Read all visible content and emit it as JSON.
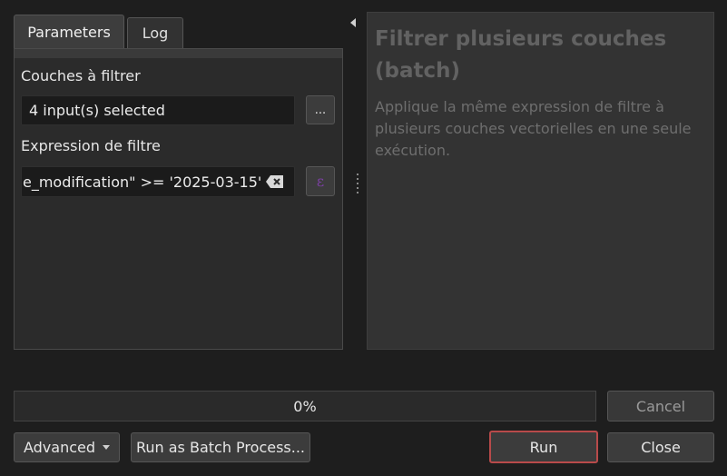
{
  "tabs": [
    {
      "label": "Parameters"
    },
    {
      "label": "Log"
    }
  ],
  "params": {
    "layers_label": "Couches à filtrer",
    "layers_value": "4 input(s) selected",
    "layers_browse": "...",
    "expr_label": "Expression de filtre",
    "expr_value": "e_modification\" >= '2025-03-15'"
  },
  "help": {
    "title": "Filtrer plusieurs couches (batch)",
    "description": "Applique la même expression de filtre à plusieurs couches vectorielles en une seule exécution."
  },
  "progress": {
    "value": 0,
    "text": "0%"
  },
  "buttons": {
    "cancel": "Cancel",
    "advanced": "Advanced",
    "batch": "Run as Batch Process...",
    "run": "Run",
    "close": "Close"
  },
  "colors": {
    "run_border": "#b84a4a",
    "expression_icon": "#7a3fa0"
  },
  "icons": {
    "clear": "backspace-clear-icon",
    "expression": "epsilon-expression-icon",
    "collapse": "triangle-left-icon",
    "splitter": "splitter-handle-icon"
  }
}
